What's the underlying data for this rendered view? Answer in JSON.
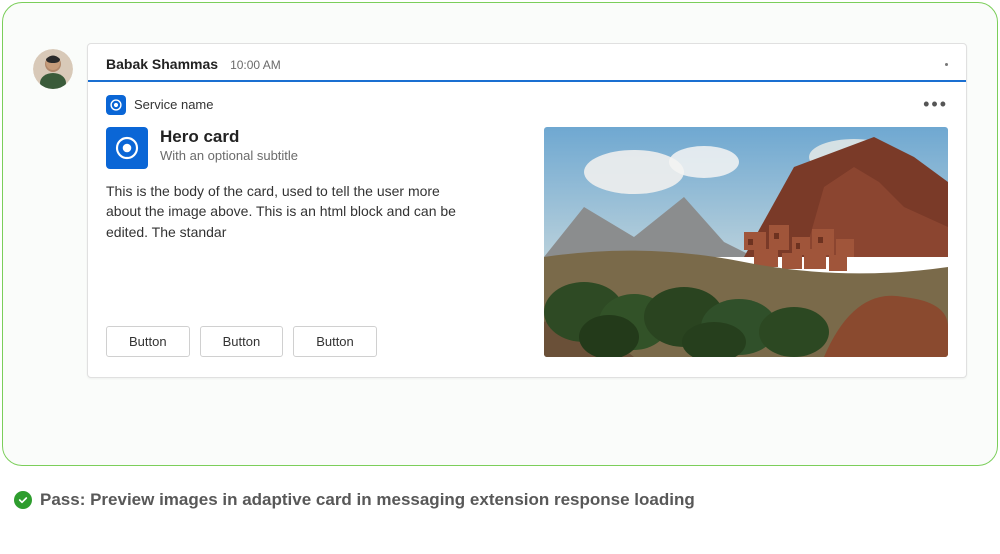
{
  "message": {
    "sender_name": "Babak Shammas",
    "timestamp": "10:00 AM"
  },
  "card": {
    "service_name": "Service name",
    "hero_title": "Hero card",
    "hero_subtitle": "With an optional subtitle",
    "body_text": "This is the body of the card, used to tell the user more about the image above. This is an html block and can be edited. The standar",
    "buttons": [
      "Button",
      "Button",
      "Button"
    ],
    "more_dots": "•••"
  },
  "status": {
    "text": "Pass: Preview images in adaptive card in messaging extension response loading"
  }
}
